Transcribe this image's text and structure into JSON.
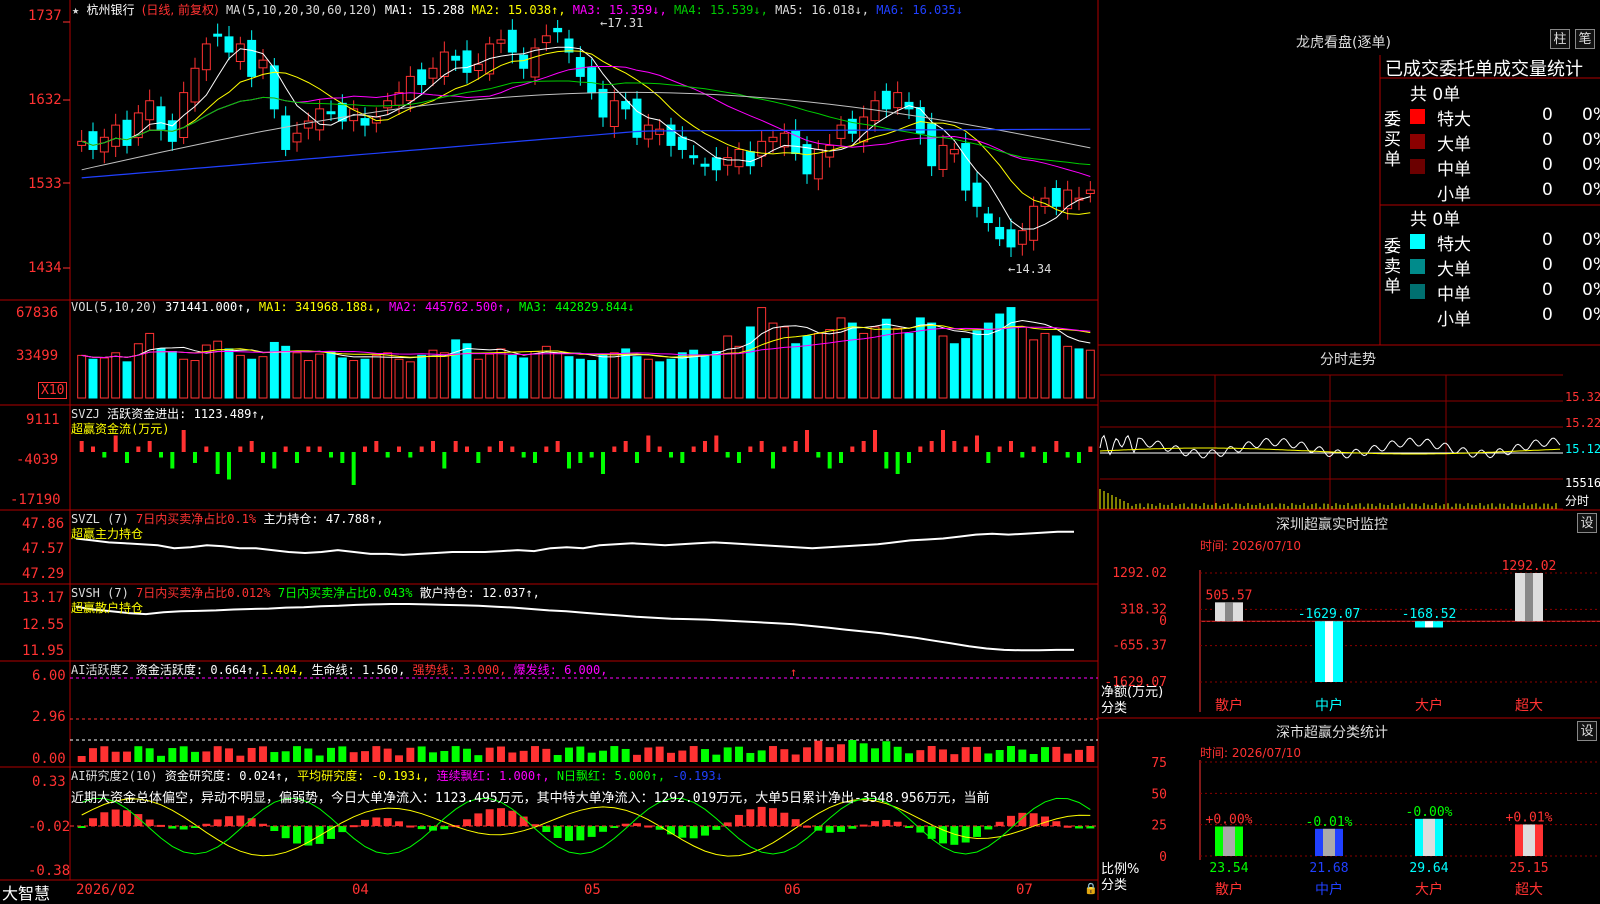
{
  "colors": {
    "up": "#ff3232",
    "down": "#00ffff",
    "grid": "#b00000",
    "axis": "#ff3232",
    "ma1": "#ffffff",
    "ma2": "#ffff00",
    "ma3": "#ff00ff",
    "ma4": "#00cc00",
    "ma5": "#c0c0c0",
    "ma6": "#2040ff",
    "green": "#00ff00"
  },
  "app_name": "大智慧",
  "price_header": {
    "star": "★",
    "stock": "杭州银行",
    "mode": "(日线, 前复权)",
    "ma_params": "MA(5,10,20,30,60,120)",
    "ma1": "MA1: 15.288",
    "ma2": "MA2: 15.038↑,",
    "ma3": "MA3: 15.359↓,",
    "ma4": "MA4: 15.539↓,",
    "ma5": "MA5: 16.018↓,",
    "ma6": "MA6: 16.035↓"
  },
  "price_axis": [
    "1737",
    "1632",
    "1533",
    "1434"
  ],
  "price_annotations": {
    "high": "17.31",
    "low": "14.34"
  },
  "vol_header": {
    "name": "VOL(5,10,20)",
    "val": "371441.000↑,",
    "ma1": "MA1: 341968.188↓,",
    "ma2": "MA2: 445762.500↑,",
    "ma3": "MA3: 442829.844↓"
  },
  "vol_axis": [
    "67836",
    "33499"
  ],
  "vol_unit": "X10",
  "svzj_header": {
    "name": "SVZJ",
    "text": "活跃资金进出: 1123.489↑,",
    "sub": "超赢资金流(万元)"
  },
  "svzj_axis": [
    "9111",
    "-4039",
    "-17190"
  ],
  "svzl_header": {
    "name": "SVZL (7)",
    "t1": "7日内买卖净占比0.1%",
    "t2": "主力持仓: 47.788↑,",
    "sub": "超赢主力持仓"
  },
  "svzl_axis": [
    "47.86",
    "47.57",
    "47.29"
  ],
  "svsh_header": {
    "name": "SVSH (7)",
    "t1": "7日内买卖净占比0.012%",
    "t2": "7日内买卖净占比0.043%",
    "t3": "散户持仓: 12.037↑,",
    "sub": "超赢散户持仓"
  },
  "svsh_axis": [
    "13.17",
    "12.55",
    "11.95"
  ],
  "ai1_header": {
    "name": "AI活跃度2",
    "t1": "资金活跃度: 0.664↑,",
    "t2": "1.404,",
    "t3": "生命线: 1.560,",
    "t4": "强势线: 3.000,",
    "t5": "爆发线: 6.000,"
  },
  "ai1_axis": [
    "6.00",
    "2.96",
    "0.00"
  ],
  "ai2_header": {
    "name": "AI研究度2(10)",
    "t1": "资金研究度: 0.024↑,",
    "t2": "平均研究度: -0.193↓,",
    "t3": "连续飘红: 1.000↑,",
    "t4": "N日飘红: 5.000↑,",
    "t5": "-0.193↓"
  },
  "ai2_note": "近期大资金总体偏空，异动不明显，偏弱势，今日大单净流入：1123.495万元，其中特大单净流入：1292.019万元，大单5日累计净出-3548.956万元，当前",
  "ai2_axis": [
    "0.33",
    "-0.02",
    "-0.38"
  ],
  "x_axis": [
    "2026/02",
    "04",
    "05",
    "06",
    "07"
  ],
  "lhb": {
    "title": "龙虎看盘(逐单)",
    "btn1": "柱",
    "btn2": "笔",
    "subtitle": "已成交委托单成交量统计",
    "buy_label": "委买单",
    "sell_label": "委卖单",
    "buy_total": "共 0单",
    "sell_total": "共 0单",
    "buy_rows": [
      {
        "name": "特大",
        "n": "0",
        "p": "0%",
        "c": "#ff0000"
      },
      {
        "name": "大单",
        "n": "0",
        "p": "0%",
        "c": "#8b0000"
      },
      {
        "name": "中单",
        "n": "0",
        "p": "0%",
        "c": "#6b0000"
      },
      {
        "name": "小单",
        "n": "0",
        "p": "0%",
        "c": "#000000"
      }
    ],
    "sell_rows": [
      {
        "name": "特大",
        "n": "0",
        "p": "0%",
        "c": "#00ffff"
      },
      {
        "name": "大单",
        "n": "0",
        "p": "0%",
        "c": "#008b8b"
      },
      {
        "name": "中单",
        "n": "0",
        "p": "0%",
        "c": "#007070"
      },
      {
        "name": "小单",
        "n": "0",
        "p": "0%",
        "c": "#000000"
      }
    ]
  },
  "fenshi": {
    "title": "分时走势",
    "axis": [
      "15.32",
      "15.22",
      "15.12"
    ],
    "vol_label": "15516",
    "vol_unit": "分时"
  },
  "monitor": {
    "title": "深圳超赢实时监控",
    "btn": "设",
    "time": "时间: 2026/07/10",
    "axis": [
      "1292.02",
      "318.32",
      "0",
      "-655.37",
      "-1629.07"
    ],
    "ylabel": "净额(万元)",
    "xlabel": "分类",
    "bars": [
      {
        "name": "散户",
        "label": "505.57"
      },
      {
        "name": "中户",
        "label": "-1629.07"
      },
      {
        "name": "大户",
        "label": "-168.52"
      },
      {
        "name": "超大",
        "label": "1292.02"
      }
    ]
  },
  "classify": {
    "title": "深市超赢分类统计",
    "btn": "设",
    "time": "时间: 2026/07/10",
    "axis": [
      "75",
      "50",
      "25",
      "0"
    ],
    "ylabel": "比例%",
    "xlabel": "分类",
    "bars": [
      {
        "name": "散户",
        "top": "+0.00%",
        "bottom": "23.54"
      },
      {
        "name": "中户",
        "top": "-0.01%",
        "bottom": "21.68"
      },
      {
        "name": "大户",
        "top": "-0.00%",
        "bottom": "29.64"
      },
      {
        "name": "超大",
        "top": "+0.01%",
        "bottom": "25.15"
      }
    ]
  },
  "chart_data": [
    {
      "type": "candlestick",
      "title": "杭州银行 (日线, 前复权)",
      "x_range": [
        "2026/02",
        "2026/07/10"
      ],
      "ylim": [
        14.34,
        17.31
      ],
      "ticks": [
        17.37,
        16.32,
        15.33,
        14.34
      ],
      "close": [
        15.9,
        15.8,
        15.95,
        16.1,
        15.85,
        16.25,
        16.4,
        16.05,
        15.9,
        16.5,
        16.8,
        17.1,
        17.2,
        17.0,
        17.1,
        16.7,
        16.9,
        16.3,
        15.8,
        16.0,
        16.15,
        16.3,
        16.25,
        16.15,
        16.3,
        16.1,
        16.2,
        16.4,
        16.5,
        16.7,
        16.6,
        16.8,
        17.0,
        16.9,
        16.75,
        16.85,
        17.1,
        17.15,
        17.0,
        16.8,
        17.05,
        17.2,
        17.25,
        17.0,
        16.7,
        16.5,
        16.2,
        16.4,
        16.3,
        15.95,
        16.1,
        16.05,
        15.85,
        15.8,
        15.7,
        15.6,
        15.55,
        15.7,
        15.8,
        15.6,
        15.9,
        15.95,
        16.0,
        15.75,
        15.5,
        15.8,
        15.85,
        16.1,
        16.0,
        16.2,
        16.4,
        16.3,
        16.5,
        16.3,
        16.0,
        15.6,
        15.85,
        15.8,
        15.3,
        15.1,
        14.9,
        14.7,
        14.6,
        14.8,
        15.1,
        15.2,
        15.1,
        15.3,
        15.2,
        15.3
      ],
      "ma_lines": [
        "MA1",
        "MA2",
        "MA3",
        "MA4",
        "MA5",
        "MA6"
      ]
    },
    {
      "type": "bar",
      "title": "VOL(5,10,20)",
      "unit": "X10",
      "ylim": [
        0,
        67836
      ],
      "values": [
        33,
        30,
        31,
        35,
        28,
        42,
        50,
        38,
        36,
        30,
        29,
        41,
        44,
        38,
        33,
        30,
        32,
        43,
        40,
        35,
        29,
        34,
        36,
        31,
        29,
        30,
        33,
        35,
        30,
        28,
        33,
        37,
        35,
        45,
        42,
        30,
        34,
        38,
        33,
        31,
        36,
        40,
        35,
        32,
        30,
        29,
        33,
        35,
        38,
        32,
        30,
        28,
        30,
        35,
        37,
        33,
        36,
        48,
        40,
        55,
        70,
        58,
        55,
        42,
        48,
        50,
        53,
        62,
        58,
        50,
        55,
        61,
        54,
        50,
        62,
        58,
        48,
        42,
        46,
        52,
        58,
        65,
        70,
        55,
        45,
        50,
        48,
        40,
        38,
        37
      ]
    },
    {
      "type": "bar",
      "title": "SVZJ 超赢资金流(万元)",
      "ylim": [
        -17190,
        9111
      ],
      "values": [
        2,
        1,
        -1,
        3,
        -2,
        1,
        2,
        -1,
        -3,
        4,
        -2,
        1,
        -4,
        -5,
        1,
        2,
        -2,
        -3,
        1,
        -2,
        1,
        1,
        -1,
        -2,
        -6,
        1,
        2,
        -1,
        1,
        -1,
        1,
        2,
        -3,
        2,
        1,
        -2,
        1,
        2,
        1,
        -1,
        -2,
        1,
        2,
        -3,
        -2,
        -1,
        -4,
        1,
        2,
        -2,
        3,
        1,
        -1,
        -2,
        1,
        2,
        3,
        -1,
        -2,
        1,
        2,
        -3,
        1,
        2,
        4,
        -1,
        -3,
        -2,
        1,
        2,
        4,
        -3,
        -4,
        -2,
        1,
        2,
        4,
        2,
        1,
        3,
        -2,
        1,
        2,
        -1,
        1,
        -2,
        2,
        -1,
        -2,
        1
      ]
    },
    {
      "type": "line",
      "title": "SVZL 超赢主力持仓",
      "ylim": [
        47.29,
        47.86
      ],
      "values": [
        47.72,
        47.7,
        47.68,
        47.67,
        47.66,
        47.65,
        47.62,
        47.63,
        47.65,
        47.64,
        47.62,
        47.62,
        47.6,
        47.58,
        47.57,
        47.58,
        47.6,
        47.58,
        47.56,
        47.56,
        47.55,
        47.56,
        47.57,
        47.58,
        47.58,
        47.58,
        47.59,
        47.6,
        47.59,
        47.62,
        47.63,
        47.62,
        47.65,
        47.66,
        47.67,
        47.66,
        47.65,
        47.66,
        47.67,
        47.68,
        47.67,
        47.66,
        47.65,
        47.64,
        47.63,
        47.62,
        47.63,
        47.64,
        47.65,
        47.66,
        47.68,
        47.7,
        47.71,
        47.72,
        47.74,
        47.76,
        47.77,
        47.76,
        47.77,
        47.78,
        47.79,
        47.79
      ]
    },
    {
      "type": "line",
      "title": "SVSH 超赢散户持仓",
      "ylim": [
        11.95,
        13.17
      ],
      "values": [
        12.98,
        12.92,
        12.88,
        12.84,
        12.82,
        12.86,
        12.88,
        12.89,
        12.9,
        12.92,
        12.93,
        12.94,
        12.96,
        12.97,
        12.99,
        13.0,
        13.02,
        13.03,
        13.04,
        13.04,
        13.03,
        13.02,
        13.01,
        13.0,
        12.98,
        12.96,
        12.93,
        12.9,
        12.88,
        12.85,
        12.82,
        12.79,
        12.76,
        12.74,
        12.72,
        12.71,
        12.7,
        12.68,
        12.66,
        12.64,
        12.62,
        12.6,
        12.56,
        12.52,
        12.48,
        12.44,
        12.4,
        12.35,
        12.3,
        12.24,
        12.18,
        12.12,
        12.07,
        12.04,
        12.03,
        12.03,
        12.04,
        12.04
      ]
    },
    {
      "type": "bar",
      "title": "AI活跃度2",
      "ylim": [
        0,
        6.0
      ],
      "lines": {
        "强势线": 3.0,
        "爆发线": 6.0,
        "生命线": 1.56
      }
    },
    {
      "type": "bar",
      "title": "AI研究度2(10)",
      "ylim": [
        -0.38,
        0.33
      ]
    },
    {
      "type": "bar",
      "title": "深圳超赢实时监控",
      "xlabel": "分类",
      "ylabel": "净额(万元)",
      "categories": [
        "散户",
        "中户",
        "大户",
        "超大"
      ],
      "values": [
        505.57,
        -1629.07,
        -168.52,
        1292.02
      ],
      "ylim": [
        -1629.07,
        1292.02
      ]
    },
    {
      "type": "bar",
      "title": "深市超赢分类统计",
      "xlabel": "分类",
      "ylabel": "比例%",
      "categories": [
        "散户",
        "中户",
        "大户",
        "超大"
      ],
      "values": [
        23.54,
        21.68,
        29.64,
        25.15
      ],
      "ylim": [
        0,
        75
      ]
    }
  ]
}
